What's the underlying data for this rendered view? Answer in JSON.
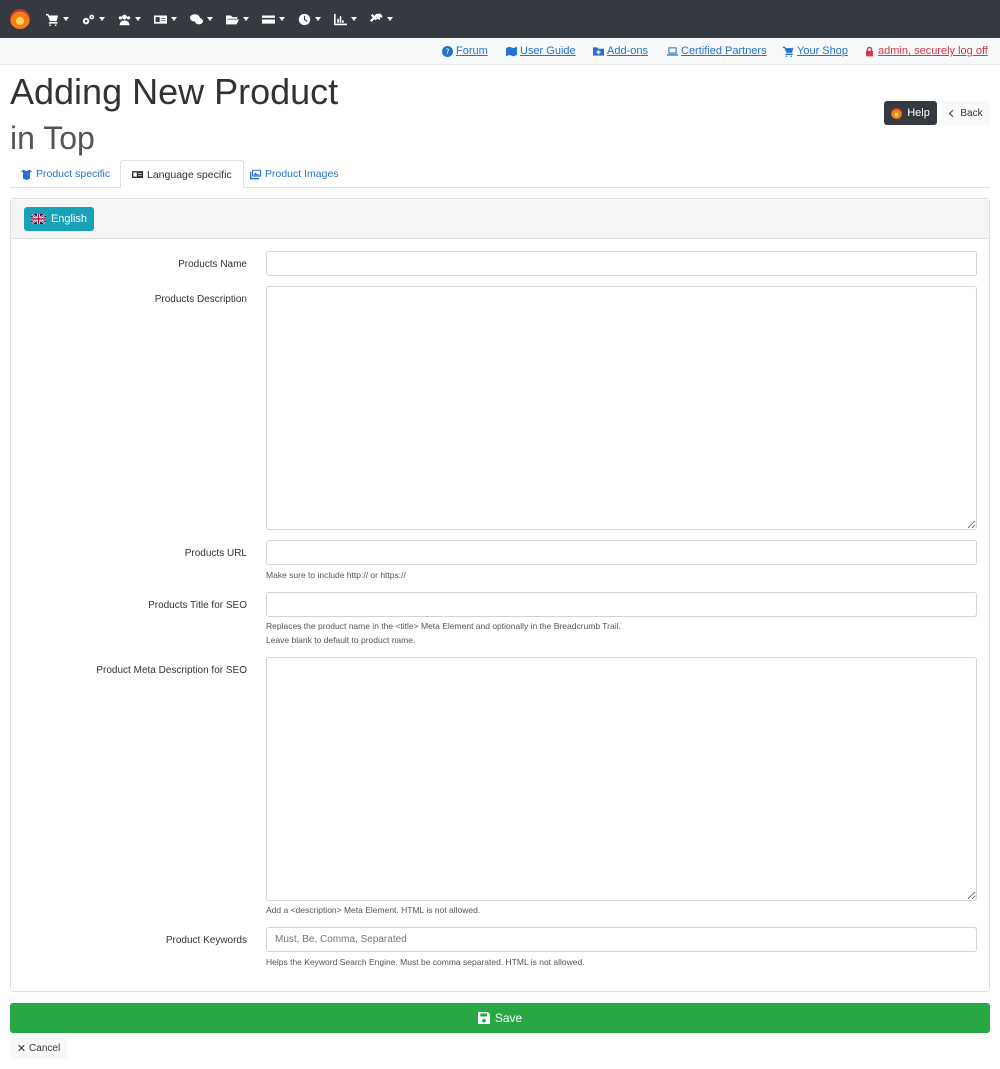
{
  "top_menu": [
    {
      "icon": "cart-icon"
    },
    {
      "icon": "gears-icon"
    },
    {
      "icon": "users-icon"
    },
    {
      "icon": "id-card-icon"
    },
    {
      "icon": "comments-icon"
    },
    {
      "icon": "folder-icon"
    },
    {
      "icon": "credit-card-icon"
    },
    {
      "icon": "clock-icon"
    },
    {
      "icon": "chart-icon"
    },
    {
      "icon": "tools-icon"
    }
  ],
  "links": {
    "forum": "Forum",
    "user_guide": "User Guide",
    "addons": "Add-ons",
    "partners": "Certified Partners",
    "shop": "Your Shop",
    "logoff": "admin, securely log off"
  },
  "page": {
    "title": "Adding New Product",
    "subtitle": "in Top",
    "help_label": "Help",
    "back_label": "Back"
  },
  "tabs": {
    "product_specific": "Product specific",
    "language_specific": "Language specific",
    "product_images": "Product Images",
    "active": "language_specific"
  },
  "language": {
    "label": "English"
  },
  "form": {
    "name_label": "Products Name",
    "name_value": "",
    "description_label": "Products Description",
    "description_value": "",
    "url_label": "Products URL",
    "url_value": "",
    "url_help": "Make sure to include http:// or https://",
    "seo_title_label": "Products Title for SEO",
    "seo_title_value": "",
    "seo_title_help_1": "Replaces the product name in the <title> Meta Element and optionally in the Breadcrumb Trail.",
    "seo_title_help_2": "Leave blank to default to product name.",
    "meta_desc_label": "Product Meta Description for SEO",
    "meta_desc_value": "",
    "meta_desc_help": "Add a <description> Meta Element. HTML is not allowed.",
    "keywords_label": "Product Keywords",
    "keywords_placeholder": "Must, Be, Comma, Separated",
    "keywords_help": "Helps the Keyword Search Engine. Must be comma separated. HTML is not allowed."
  },
  "actions": {
    "save_label": "Save",
    "cancel_label": "Cancel"
  },
  "colors": {
    "navbar": "#343a40",
    "link": "#2473d0",
    "danger": "#dc3545",
    "language_button": "#17a2b8",
    "save_button": "#28a745"
  }
}
